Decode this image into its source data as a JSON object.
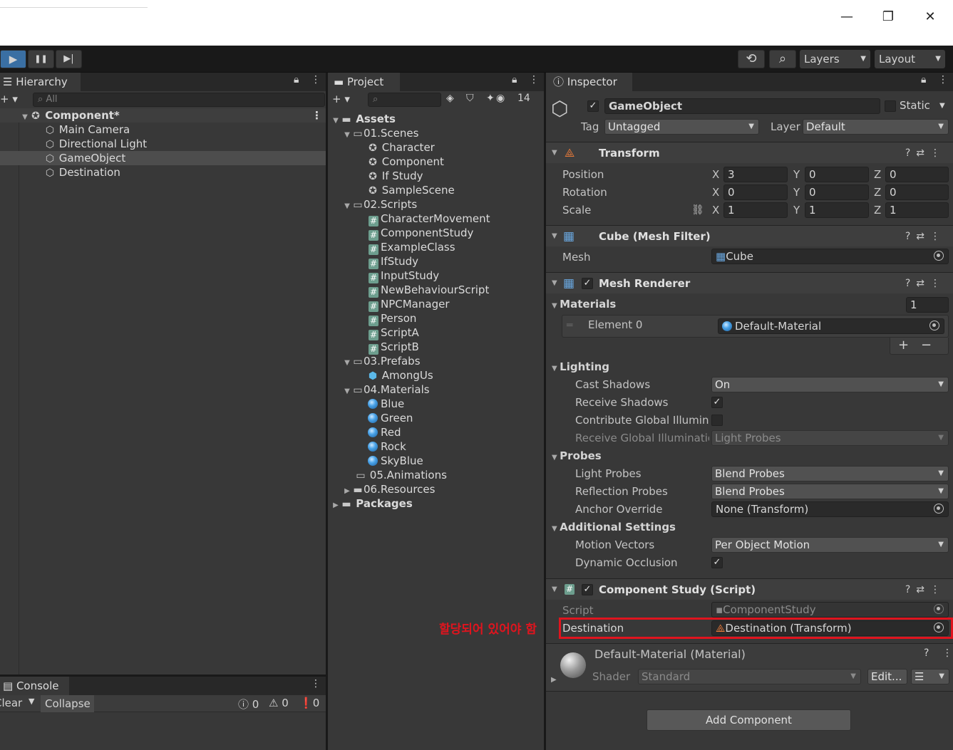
{
  "window": {
    "minimize": "—",
    "maximize": "❐",
    "close": "✕"
  },
  "toolbar": {
    "play": "▶",
    "pause": "❚❚",
    "step": "▶|",
    "history_icon": "⟲",
    "search_icon": "⌕",
    "layers": "Layers",
    "layout": "Layout"
  },
  "hierarchy": {
    "tab": "Hierarchy",
    "search_placeholder": "All",
    "scene": "Component*",
    "items": [
      "Main Camera",
      "Directional Light",
      "GameObject",
      "Destination"
    ]
  },
  "project": {
    "tab": "Project",
    "hidden_count": "14",
    "assets": "Assets",
    "folders": {
      "scenes": "01.Scenes",
      "scripts": "02.Scripts",
      "prefabs": "03.Prefabs",
      "materials": "04.Materials",
      "animations": "05.Animations",
      "resources": "06.Resources"
    },
    "scenes": [
      "Character",
      "Component",
      "If Study",
      "SampleScene"
    ],
    "scripts": [
      "CharacterMovement",
      "ComponentStudy",
      "ExampleClass",
      "IfStudy",
      "InputStudy",
      "NewBehaviourScript",
      "NPCManager",
      "Person",
      "ScriptA",
      "ScriptB"
    ],
    "prefabs": [
      "AmongUs"
    ],
    "materials": [
      "Blue",
      "Green",
      "Red",
      "Rock",
      "SkyBlue"
    ],
    "packages": "Packages"
  },
  "console": {
    "tab": "Console",
    "clear": "Clear",
    "collapse": "Collapse",
    "info_count": "0",
    "warn_count": "0",
    "error_count": "0"
  },
  "inspector": {
    "tab": "Inspector",
    "name": "GameObject",
    "static_label": "Static",
    "tag_label": "Tag",
    "tag_value": "Untagged",
    "layer_label": "Layer",
    "layer_value": "Default",
    "transform": {
      "title": "Transform",
      "position_label": "Position",
      "rotation_label": "Rotation",
      "scale_label": "Scale",
      "x": "X",
      "y": "Y",
      "z": "Z",
      "position": [
        "3",
        "0",
        "0"
      ],
      "rotation": [
        "0",
        "0",
        "0"
      ],
      "scale": [
        "1",
        "1",
        "1"
      ]
    },
    "mesh_filter": {
      "title": "Cube (Mesh Filter)",
      "mesh_label": "Mesh",
      "mesh_value": "Cube"
    },
    "mesh_renderer": {
      "title": "Mesh Renderer",
      "materials_label": "Materials",
      "materials_count": "1",
      "element0_label": "Element 0",
      "element0_value": "Default-Material",
      "add": "+",
      "remove": "−",
      "lighting_label": "Lighting",
      "cast_shadows_label": "Cast Shadows",
      "cast_shadows_value": "On",
      "receive_shadows_label": "Receive Shadows",
      "contribute_gi_label": "Contribute Global Illuminat",
      "receive_gi_label": "Receive Global Illuminatio",
      "receive_gi_value": "Light Probes",
      "probes_label": "Probes",
      "light_probes_label": "Light Probes",
      "light_probes_value": "Blend Probes",
      "reflection_probes_label": "Reflection Probes",
      "reflection_probes_value": "Blend Probes",
      "anchor_override_label": "Anchor Override",
      "anchor_override_value": "None (Transform)",
      "additional_label": "Additional Settings",
      "motion_vectors_label": "Motion Vectors",
      "motion_vectors_value": "Per Object Motion",
      "dynamic_occlusion_label": "Dynamic Occlusion"
    },
    "component_study": {
      "title": "Component Study (Script)",
      "script_label": "Script",
      "script_value": "ComponentStudy",
      "destination_label": "Destination",
      "destination_value": "Destination (Transform)",
      "annotation": "할당되어 있어야 함"
    },
    "material": {
      "title": "Default-Material (Material)",
      "shader_label": "Shader",
      "shader_value": "Standard",
      "edit": "Edit..."
    },
    "add_component": "Add Component"
  },
  "colors": {
    "accent": "#3a6fa3",
    "annotation_red": "#e0141e",
    "panel": "#383838",
    "dark": "#191919"
  }
}
